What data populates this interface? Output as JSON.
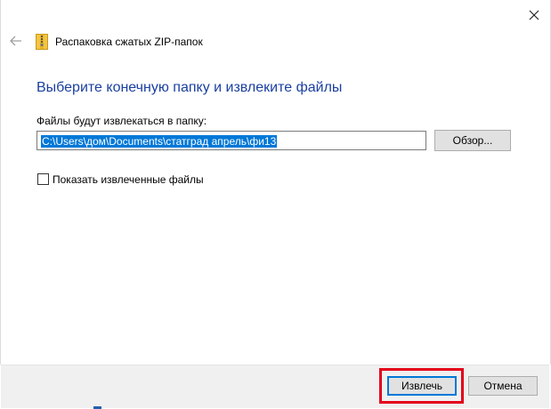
{
  "window": {
    "title": "Распаковка сжатых ZIP-папок",
    "close_icon": "close-icon",
    "back_icon": "back-arrow-icon"
  },
  "main": {
    "heading": "Выберите конечную папку и извлеките файлы",
    "path_label": "Файлы будут извлекаться в папку:",
    "path_value": "C:\\Users\\дом\\Documents\\статград апрель\\фи13",
    "browse_label": "Обзор...",
    "show_files_label": "Показать извлеченные файлы",
    "show_files_checked": false
  },
  "footer": {
    "extract_label": "Извлечь",
    "cancel_label": "Отмена"
  },
  "colors": {
    "heading": "#1a3fa0",
    "selection": "#0078d7",
    "highlight": "#e3001b",
    "footer_bg": "#f0f0f0"
  }
}
